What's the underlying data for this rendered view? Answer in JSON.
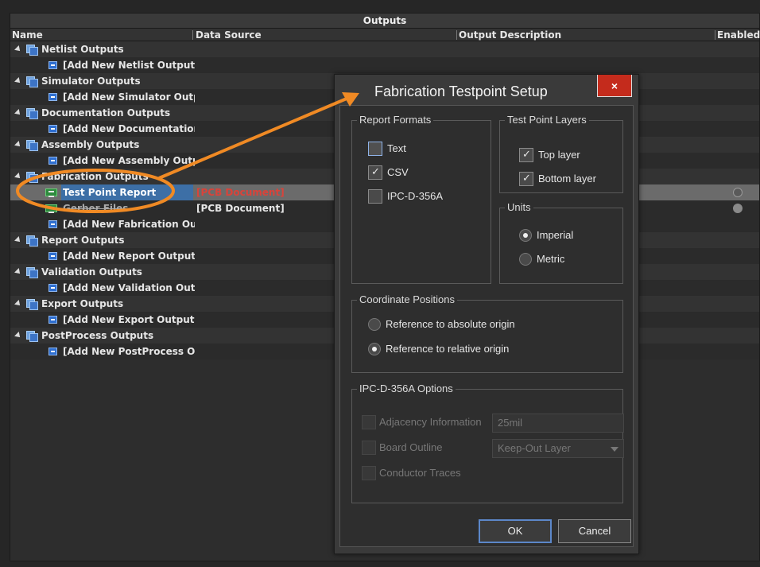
{
  "panel": {
    "title": "Outputs",
    "columns": [
      "Name",
      "Data Source",
      "Output Description",
      "Enabled"
    ]
  },
  "groups": [
    {
      "label": "Netlist Outputs",
      "children": [
        {
          "label": "[Add New Netlist Output]"
        }
      ]
    },
    {
      "label": "Simulator Outputs",
      "children": [
        {
          "label": "[Add New Simulator Outp"
        }
      ]
    },
    {
      "label": "Documentation Outputs",
      "children": [
        {
          "label": "[Add New Documentation"
        }
      ]
    },
    {
      "label": "Assembly Outputs",
      "children": [
        {
          "label": "[Add New Assembly Outpu"
        }
      ]
    },
    {
      "label": "Fabrication Outputs",
      "children": [
        {
          "label": "Test Point Report",
          "source": "[PCB Document]"
        },
        {
          "label": "Gerber Files",
          "source": "[PCB Document]"
        },
        {
          "label": "[Add New Fabrication Out"
        }
      ]
    },
    {
      "label": "Report Outputs",
      "children": [
        {
          "label": "[Add New Report Output]"
        }
      ]
    },
    {
      "label": "Validation Outputs",
      "children": [
        {
          "label": "[Add New Validation Outp"
        }
      ]
    },
    {
      "label": "Export Outputs",
      "children": [
        {
          "label": "[Add New Export Output]"
        }
      ]
    },
    {
      "label": "PostProcess Outputs",
      "children": [
        {
          "label": "[Add New PostProcess Ou"
        }
      ]
    }
  ],
  "dialog": {
    "title": "Fabrication Testpoint Setup",
    "close": "×",
    "report_formats": {
      "legend": "Report Formats",
      "text": "Text",
      "csv": "CSV",
      "ipc": "IPC-D-356A",
      "text_checked": false,
      "csv_checked": true,
      "ipc_checked": false
    },
    "test_point_layers": {
      "legend": "Test Point Layers",
      "top": "Top layer",
      "bottom": "Bottom layer"
    },
    "units": {
      "legend": "Units",
      "imperial": "Imperial",
      "metric": "Metric",
      "selected": "Imperial"
    },
    "coordinate_positions": {
      "legend": "Coordinate Positions",
      "absolute": "Reference to absolute origin",
      "relative": "Reference to relative origin",
      "selected": "relative"
    },
    "ipc_options": {
      "legend": "IPC-D-356A Options",
      "adjacency": "Adjacency Information",
      "adjacency_value": "25mil",
      "board_outline": "Board Outline",
      "board_outline_value": "Keep-Out Layer",
      "conductor_traces": "Conductor Traces"
    },
    "ok": "OK",
    "cancel": "Cancel"
  },
  "annotation_color": "#f08a24"
}
